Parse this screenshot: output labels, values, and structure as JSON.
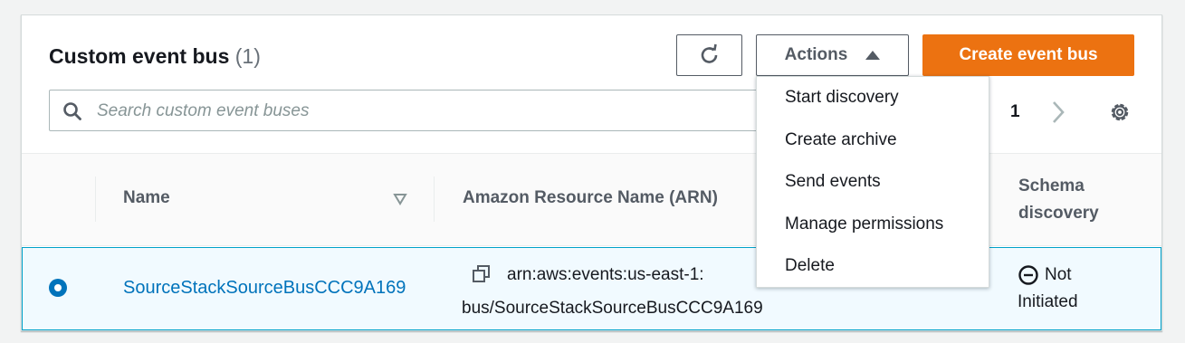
{
  "panel": {
    "title": "Custom event bus",
    "count": "(1)"
  },
  "toolbar": {
    "refresh_icon": "refresh-icon",
    "actions_label": "Actions",
    "create_label": "Create event bus"
  },
  "search": {
    "placeholder": "Search custom event buses",
    "value": ""
  },
  "pagination": {
    "current_page": "1"
  },
  "table": {
    "columns": [
      "Name",
      "Amazon Resource Name (ARN)",
      "Schema",
      "discovery"
    ],
    "rows": [
      {
        "name": "SourceStackSourceBusCCC9A169",
        "arn_line1": "arn:aws:events:us-east-1:",
        "arn_line2": "bus/SourceStackSourceBusCCC9A169",
        "status_line1": "Not",
        "status_line2": "Initiated",
        "selected": true
      }
    ]
  },
  "actions_menu": {
    "items": [
      "Start discovery",
      "Create archive",
      "Send events",
      "Manage permissions",
      "Delete"
    ]
  },
  "colors": {
    "primary": "#ec7211",
    "link": "#0073bb",
    "selected_row_bg": "#f1faff",
    "selected_row_border": "#00a1c9"
  }
}
